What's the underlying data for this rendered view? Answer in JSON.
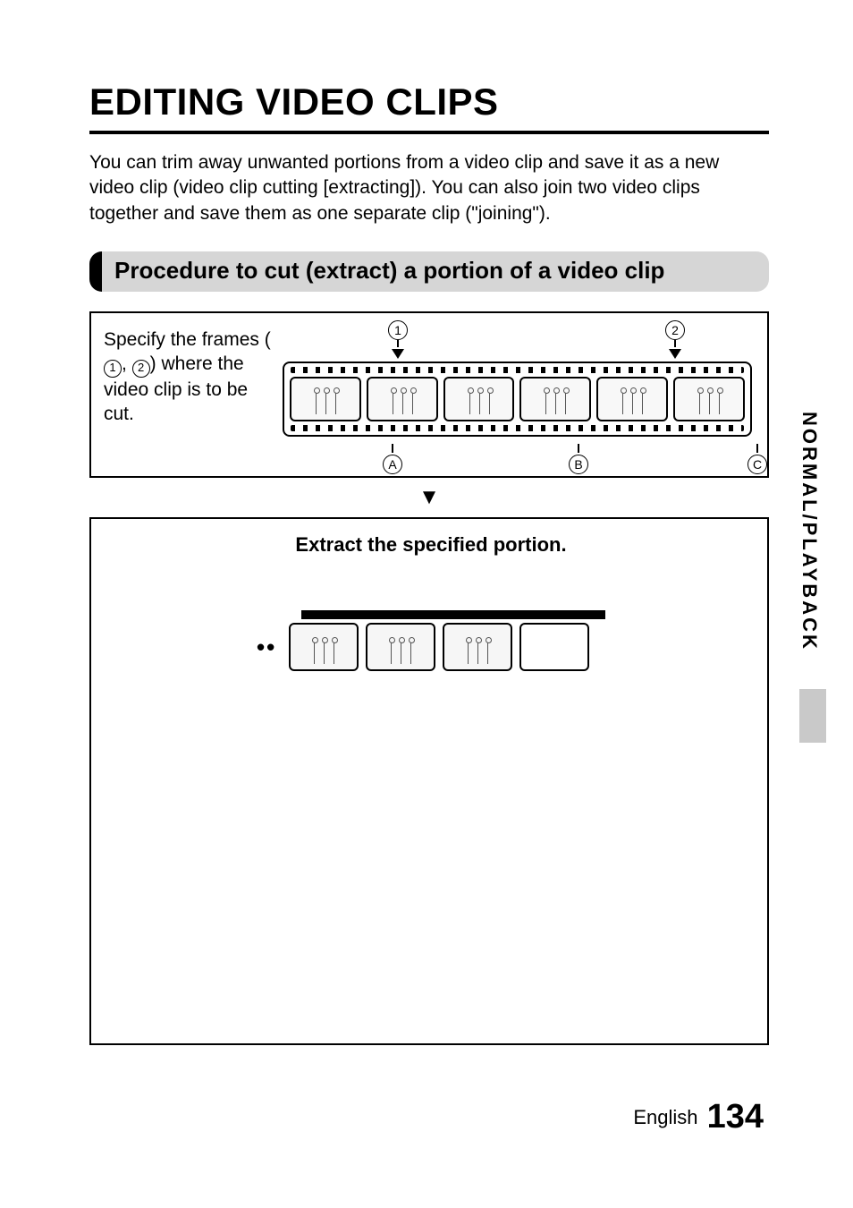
{
  "title": "EDITING VIDEO CLIPS",
  "intro": "You can trim away unwanted portions from a video clip and save it as a new video clip (video clip cutting [extracting]). You can also join two video clips together and save them as one separate clip (\"joining\").",
  "section_header": "Procedure to cut (extract) a portion of a video clip",
  "diagram1": {
    "specify_pre": "Specify the frames (",
    "circ1": "1",
    "sep": ", ",
    "circ2": "2",
    "specify_post": ") where the video clip is to be cut.",
    "marker1": "1",
    "marker2": "2",
    "segA": "A",
    "segB": "B",
    "segC": "C"
  },
  "diagram2": {
    "title": "Extract the specified portion.",
    "dots": "••"
  },
  "side_tab": "NORMAL/PLAYBACK",
  "footer_lang": "English",
  "page_number": "134"
}
